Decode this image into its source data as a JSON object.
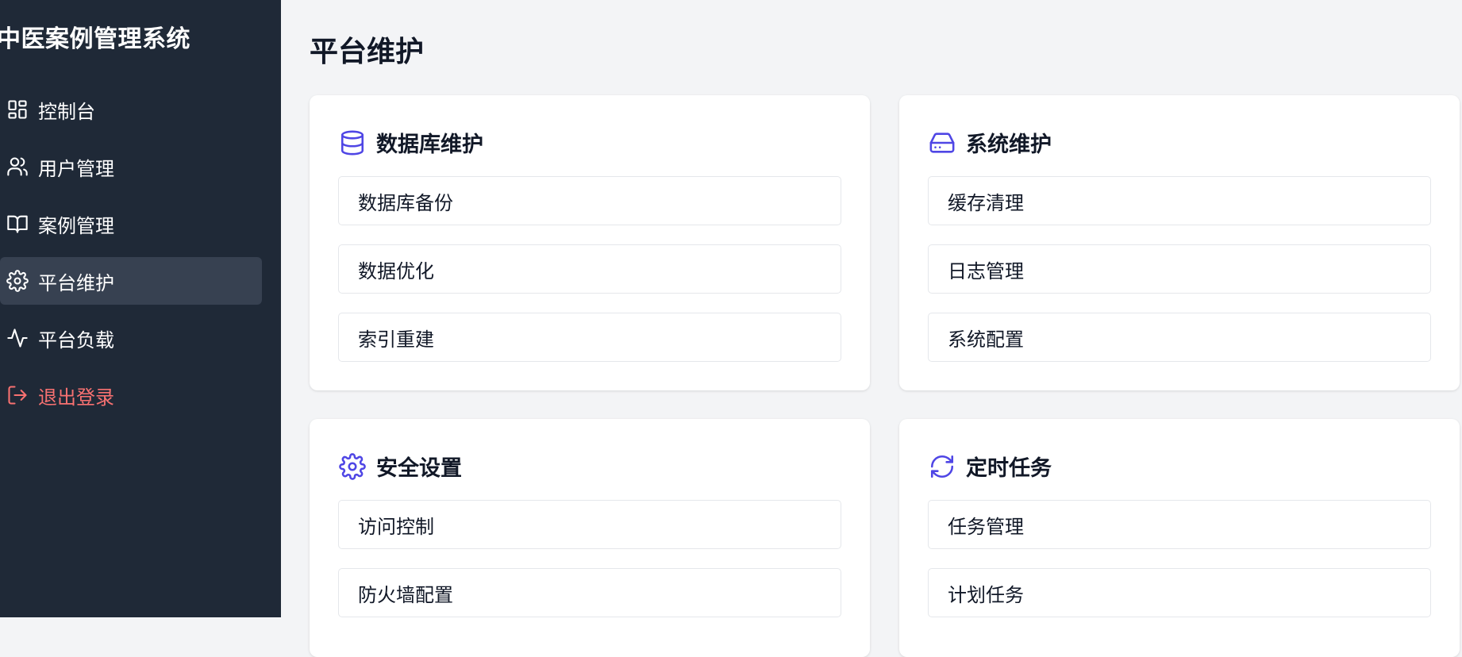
{
  "app": {
    "title": "中医案例管理系统"
  },
  "sidebar": {
    "items": [
      {
        "label": "控制台",
        "icon": "dashboard-icon"
      },
      {
        "label": "用户管理",
        "icon": "users-icon"
      },
      {
        "label": "案例管理",
        "icon": "book-icon"
      },
      {
        "label": "平台维护",
        "icon": "gear-icon",
        "active": true
      },
      {
        "label": "平台负载",
        "icon": "activity-icon"
      },
      {
        "label": "退出登录",
        "icon": "logout-icon"
      }
    ]
  },
  "page": {
    "title": "平台维护"
  },
  "cards": [
    {
      "title": "数据库维护",
      "icon": "database-icon",
      "buttons": [
        "数据库备份",
        "数据优化",
        "索引重建"
      ]
    },
    {
      "title": "系统维护",
      "icon": "hard-drive-icon",
      "buttons": [
        "缓存清理",
        "日志管理",
        "系统配置"
      ]
    },
    {
      "title": "安全设置",
      "icon": "gear-icon",
      "buttons": [
        "访问控制",
        "防火墙配置"
      ]
    },
    {
      "title": "定时任务",
      "icon": "refresh-icon",
      "buttons": [
        "任务管理",
        "计划任务"
      ]
    }
  ],
  "colors": {
    "sidebar_bg": "#1f2937",
    "active_item_bg": "#374151",
    "logout_text": "#f87171",
    "accent": "#4f46e5",
    "page_bg": "#f3f4f6"
  }
}
